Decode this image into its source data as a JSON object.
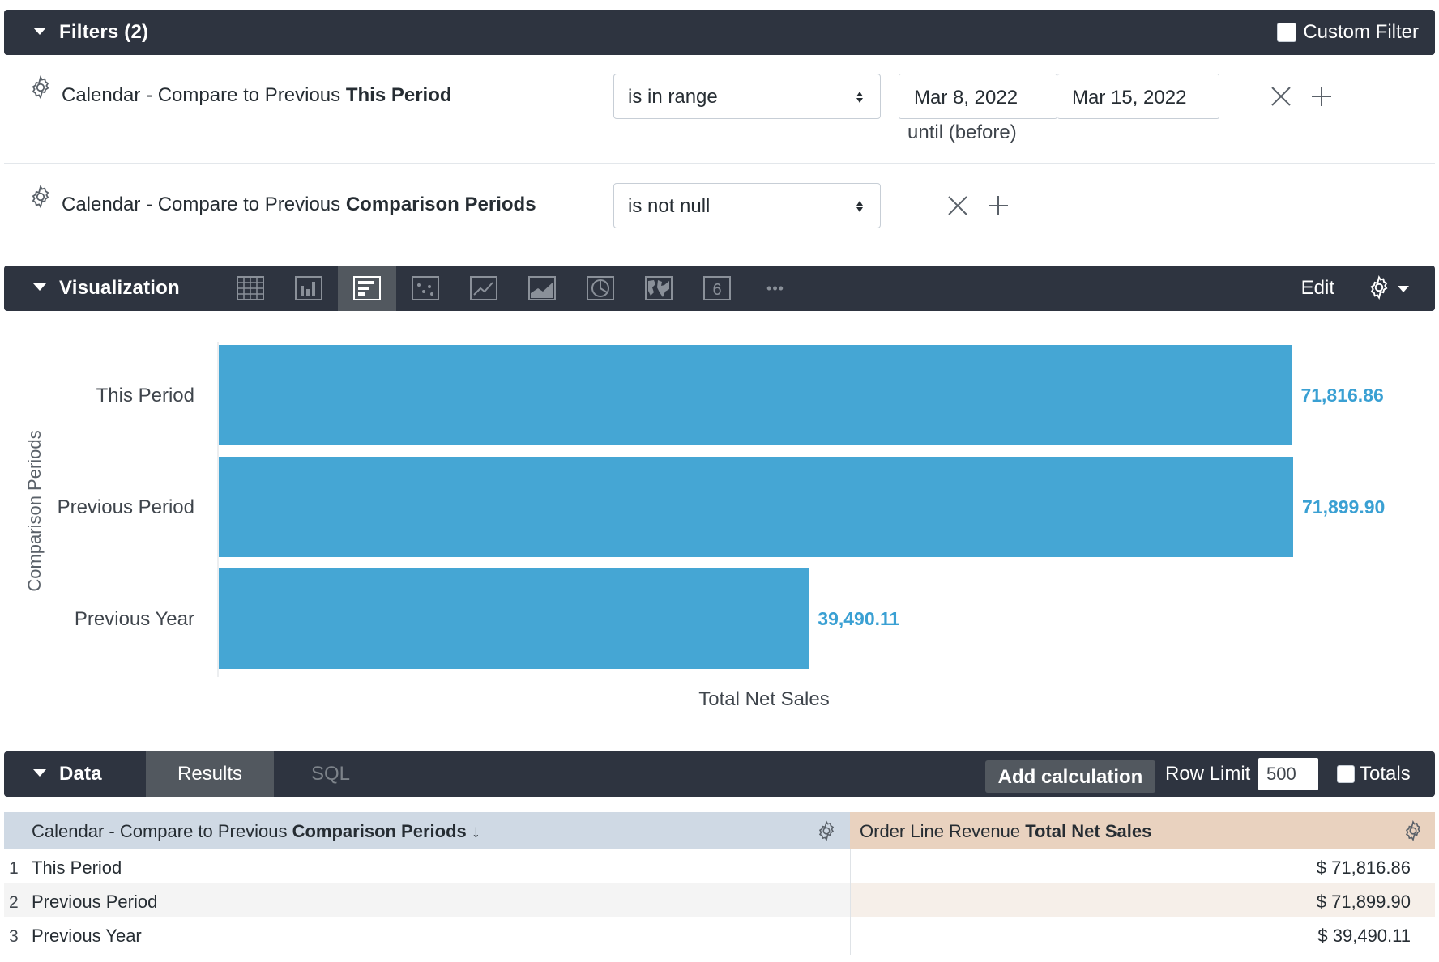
{
  "filters": {
    "title": "Filters (2)",
    "custom_filter_label": "Custom Filter",
    "rows": [
      {
        "field_prefix": "Calendar - Compare to Previous ",
        "field_name": "This Period",
        "operator": "is in range",
        "date_from": "Mar 8, 2022",
        "date_to": "Mar 15, 2022",
        "hint": "until (before)"
      },
      {
        "field_prefix": "Calendar - Compare to Previous ",
        "field_name": "Comparison Periods",
        "operator": "is not null"
      }
    ]
  },
  "visualization": {
    "title": "Visualization",
    "edit_label": "Edit",
    "active_type": "bar",
    "type_icons": [
      "table-icon",
      "column-chart-icon",
      "bar-chart-icon",
      "scatter-chart-icon",
      "line-chart-icon",
      "area-chart-icon",
      "pie-chart-icon",
      "map-icon",
      "single-value-icon",
      "more-icon"
    ],
    "single_value_glyph": "6",
    "more_glyph": "•••"
  },
  "chart_data": {
    "type": "bar",
    "orientation": "horizontal",
    "categories": [
      "This Period",
      "Previous Period",
      "Previous Year"
    ],
    "values": [
      71816.86,
      71899.9,
      39490.11
    ],
    "value_labels": [
      "71,816.86",
      "71,899.90",
      "39,490.11"
    ],
    "xlabel": "Total Net Sales",
    "ylabel": "Comparison Periods",
    "xlim": [
      0,
      71899.9
    ],
    "grid": false,
    "bar_color": "#45a6d4",
    "label_color": "#3aa0d3"
  },
  "data_panel": {
    "title": "Data",
    "tabs": [
      "Results",
      "SQL"
    ],
    "add_calculation_label": "Add calculation",
    "row_limit_label": "Row Limit",
    "row_limit_value": "500",
    "totals_label": "Totals",
    "table": {
      "dim_header_prefix": "Calendar - Compare to Previous ",
      "dim_header_name": "Comparison Periods",
      "sort_arrow": "↓",
      "meas_header_prefix": "Order Line Revenue ",
      "meas_header_name": "Total Net Sales",
      "rows": [
        {
          "num": "1",
          "period": "This Period",
          "sales": "$ 71,816.86"
        },
        {
          "num": "2",
          "period": "Previous Period",
          "sales": "$ 71,899.90"
        },
        {
          "num": "3",
          "period": "Previous Year",
          "sales": "$ 39,490.11"
        }
      ]
    }
  },
  "colors": {
    "header_bg": "#2e3440",
    "active_tab": "#52585f",
    "dim_header": "#cfd9e4",
    "measure_header": "#e9d2bf"
  }
}
